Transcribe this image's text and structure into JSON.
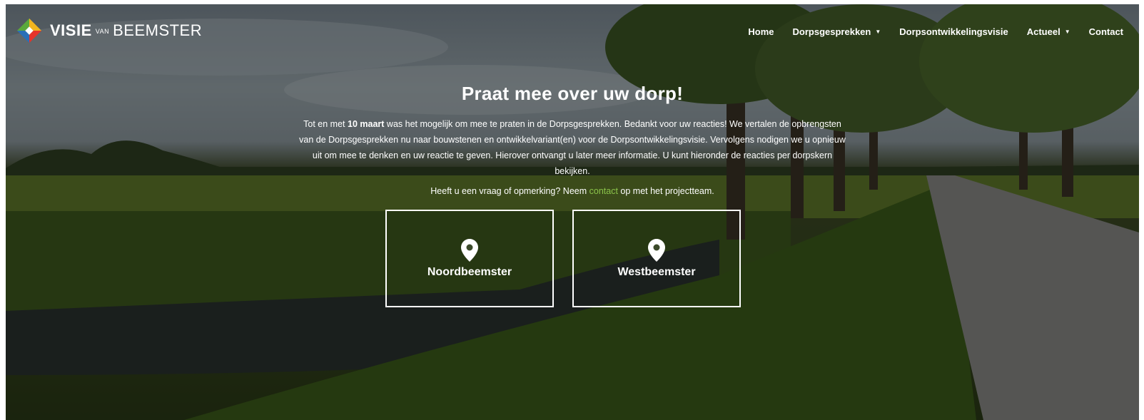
{
  "logo": {
    "word1": "VISIE",
    "word2": "VAN",
    "word3": "BEEMSTER",
    "icon": "diamond-logo-icon"
  },
  "nav": {
    "items": [
      {
        "label": "Home",
        "dropdown": false
      },
      {
        "label": "Dorpsgesprekken",
        "dropdown": true
      },
      {
        "label": "Dorpsontwikkelingsvisie",
        "dropdown": false
      },
      {
        "label": "Actueel",
        "dropdown": true
      },
      {
        "label": "Contact",
        "dropdown": false
      }
    ],
    "caret": "▼"
  },
  "hero": {
    "title": "Praat mee over uw dorp!",
    "intro_before": "Tot en met ",
    "intro_bold": "10 maart",
    "intro_after": " was het mogelijk om mee te praten in de Dorpsgesprekken. Bedankt voor uw reacties! We vertalen de opbrengsten van de Dorpsgesprekken nu naar bouwstenen en ontwikkelvariant(en) voor de Dorpsontwikkelingsvisie. Vervolgens nodigen we u opnieuw uit om mee te denken en uw reactie te geven. Hierover ontvangt u later meer informatie. U kunt hieronder de reacties per dorpskern bekijken.",
    "question_before": "Heeft u een vraag of opmerking? Neem ",
    "question_link": "contact",
    "question_after": " op met het projectteam."
  },
  "cards": [
    {
      "label": "Noordbeemster",
      "icon": "map-pin-icon"
    },
    {
      "label": "Westbeemster",
      "icon": "map-pin-icon"
    }
  ],
  "colors": {
    "link": "#8bc34a",
    "text": "#ffffff"
  }
}
